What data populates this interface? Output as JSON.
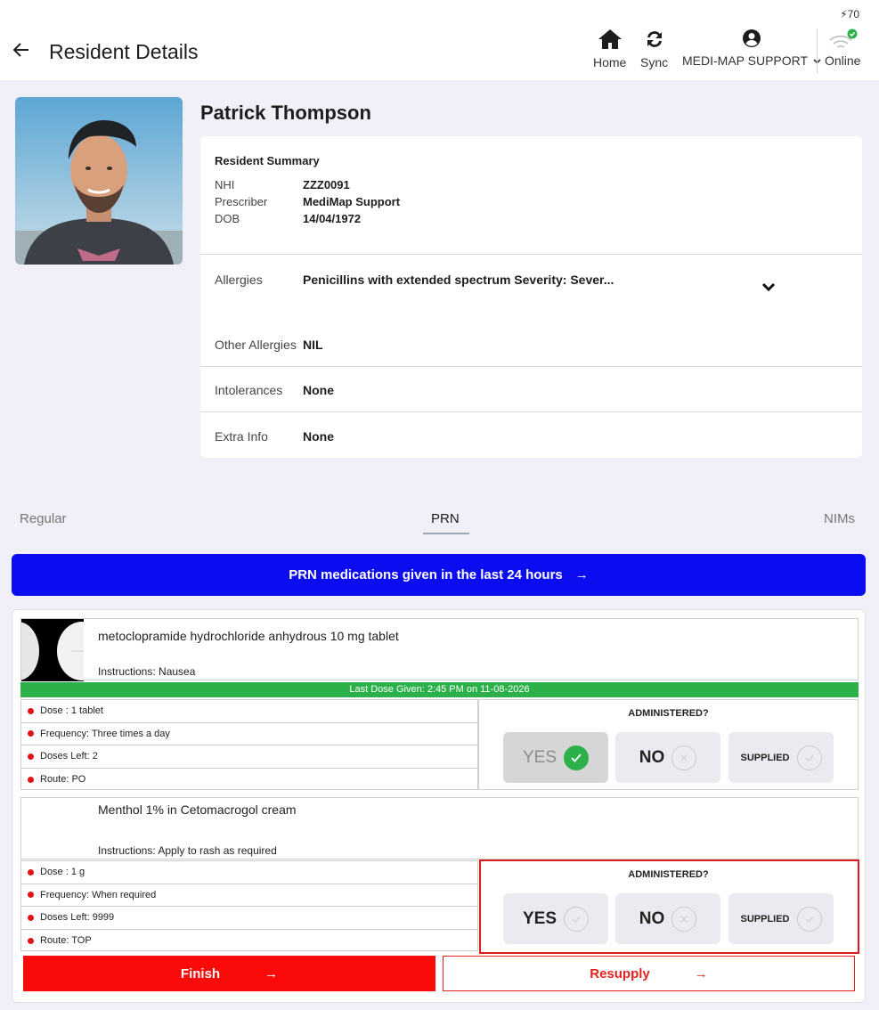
{
  "status": {
    "battery": "70"
  },
  "header": {
    "title": "Resident Details",
    "nav": {
      "home": "Home",
      "sync": "Sync",
      "user": "MEDI-MAP SUPPORT",
      "online": "Online"
    }
  },
  "resident": {
    "name": "Patrick Thompson",
    "summary_title": "Resident Summary",
    "fields": [
      {
        "label": "NHI",
        "value": "ZZZ0091"
      },
      {
        "label": "Prescriber",
        "value": "MediMap Support"
      },
      {
        "label": "DOB",
        "value": "14/04/1972"
      }
    ],
    "allergies_label": "Allergies",
    "allergies_value": "Penicillins with extended spectrum Severity: Sever...",
    "other_allergies_label": "Other Allergies",
    "other_allergies_value": "NIL",
    "intolerances_label": "Intolerances",
    "intolerances_value": "None",
    "extra_info_label": "Extra Info",
    "extra_info_value": "None"
  },
  "tabs": [
    "Regular",
    "PRN",
    "NIMs"
  ],
  "active_tab": "PRN",
  "prn_bar": {
    "label": "PRN medications given in the last 24 hours",
    "arrow": "→"
  },
  "medications": [
    {
      "name": "metoclopramide hydrochloride anhydrous 10 mg tablet",
      "instructions": "Instructions: Nausea",
      "last_dose": "Last Dose Given: 2:45 PM on 11-08-2026",
      "details": [
        "Dose : 1 tablet",
        "Frequency: Three times a day",
        "Doses Left: 2",
        "Route: PO"
      ],
      "administered_title": "ADMINISTERED?",
      "choices": [
        "YES",
        "NO",
        "SUPPLIED"
      ],
      "selected": "YES"
    },
    {
      "name": "Menthol 1% in Cetomacrogol cream",
      "instructions": "Instructions: Apply to rash as required",
      "details": [
        "Dose : 1 g",
        "Frequency: When required",
        "Doses Left: 9999",
        "Route: TOP"
      ],
      "administered_title": "ADMINISTERED?",
      "choices": [
        "YES",
        "NO",
        "SUPPLIED"
      ],
      "selected": ""
    }
  ],
  "actions": {
    "finish": "Finish",
    "resupply": "Resupply",
    "arrow": "→"
  },
  "colors": {
    "prn_bar": "#0c0cf0",
    "last_dose": "#2cb14a",
    "finish": "#fb0a0a",
    "highlight": "#dc1b1b"
  }
}
